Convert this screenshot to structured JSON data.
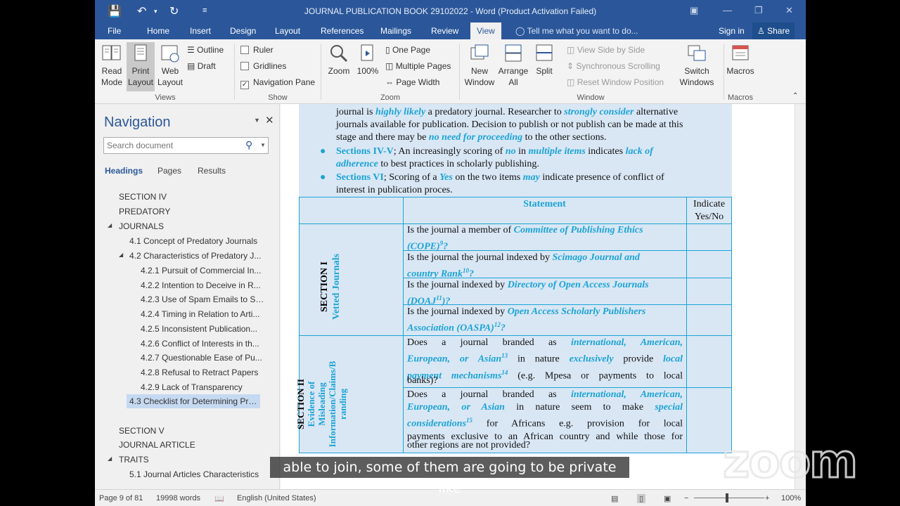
{
  "window": {
    "title": "JOURNAL PUBLICATION BOOK 29102022  -  Word (Product Activation Failed)"
  },
  "tabs": [
    "File",
    "Home",
    "Insert",
    "Design",
    "Layout",
    "References",
    "Mailings",
    "Review",
    "View"
  ],
  "tell_me": "Tell me what you want to do...",
  "sign_in": "Sign in",
  "share": "Share",
  "ribbon": {
    "views": {
      "read_mode": "Read Mode",
      "print_layout": "Print Layout",
      "web_layout": "Web Layout",
      "outline": "Outline",
      "draft": "Draft",
      "group": "Views"
    },
    "show": {
      "ruler": "Ruler",
      "gridlines": "Gridlines",
      "nav_pane": "Navigation Pane",
      "group": "Show"
    },
    "zoom": {
      "zoom": "Zoom",
      "hundred": "100%",
      "one_page": "One Page",
      "multiple_pages": "Multiple Pages",
      "page_width": "Page Width",
      "group": "Zoom"
    },
    "window": {
      "new_window": "New Window",
      "arrange_all": "Arrange All",
      "split": "Split",
      "side_by_side": "View Side by Side",
      "sync_scrolling": "Synchronous Scrolling",
      "reset_position": "Reset Window Position",
      "switch_windows": "Switch Windows",
      "group": "Window"
    },
    "macros": {
      "macros": "Macros",
      "group": "Macros"
    }
  },
  "navigation": {
    "title": "Navigation",
    "search_placeholder": "Search document",
    "tabs": [
      "Headings",
      "Pages",
      "Results"
    ],
    "items": [
      "SECTION IV",
      "PREDATORY",
      "JOURNALS",
      "4.1 Concept of Predatory Journals",
      "4.2 Characteristics of Predatory J...",
      "4.2.1 Pursuit of Commercial In...",
      "4.2.2 Intention to Deceive in R...",
      "4.2.3 Use of Spam Emails to So...",
      "4.2.4 Timing in Relation to Arti...",
      "4.2.5 Inconsistent Publication...",
      "4.2.6 Conflict of Interests in th...",
      "4.2.7 Questionable Ease of Pu...",
      "4.2.8 Refusal to Retract Papers",
      "4.2.9  Lack of Transparency",
      "4.3 Checklist for Determining Pre...",
      "SECTION V",
      "JOURNAL ARTICLE",
      "TRAITS",
      "5.1 Journal Articles Characteristics"
    ]
  },
  "document": {
    "intro": {
      "l1a": "journal is ",
      "l1b": "highly likely",
      "l1c": " a predatory journal. Researcher to ",
      "l1d": "strongly consider",
      "l1e": " alternative",
      "l2": "journals available for publication. Decision to publish or not publish can be made at this",
      "l3a": "stage and there may be ",
      "l3b": "no need for proceeding",
      "l3c": " to the other sections.",
      "b1a": "Sections IV-V",
      "b1b": "; An increasingly scoring of ",
      "b1c": "no",
      "b1d": " in ",
      "b1e": "multiple items",
      "b1f": " indicates ",
      "b1g": "lack of",
      "b1h": "adherence",
      "b1i": " to best practices in scholarly publishing.",
      "b2a": "Sections VI",
      "b2b": "; Scoring of a ",
      "b2c": "Yes",
      "b2d": " on the two items ",
      "b2e": "may",
      "b2f": " indicate presence of conflict of",
      "b2g": "interest in publication proces."
    },
    "table": {
      "header_statement": "Statement",
      "header_indicate_1": "Indicate",
      "header_indicate_2": "Yes/No",
      "section1": "SECTION I",
      "section1_sub": "Vetted Journals",
      "section2": "SECTION II",
      "section2_sub_1": "Evidence of",
      "section2_sub_2": "Misleading",
      "section2_sub_3": "Information/Claims/B",
      "section2_sub_4": "randing",
      "r1a": "Is the journal a member of ",
      "r1b": "Committee of Publishing Ethics",
      "r1c": "(COPE)",
      "r1sup": "9",
      "r1d": "?",
      "r2a": "Is the journal the journal indexed by ",
      "r2b": "Scimago Journal and",
      "r2c": "country Rank",
      "r2sup": "10",
      "r2d": "?",
      "r3a": "Is the journal indexed by ",
      "r3b": "Directory of Open Access Journals",
      "r3c": "(DOAJ",
      "r3sup": "11",
      "r3d": ")?",
      "r4a": "Is the journal indexed by ",
      "r4b": "Open Access Scholarly Publishers",
      "r4c": "Association (OASPA)",
      "r4sup": "12",
      "r4d": "?",
      "r5a": "Does a journal branded as ",
      "r5b": "international, American,",
      "r5c": "European, or Asian",
      "r5sup": "13",
      "r5d": " in nature ",
      "r5e": "exclusively",
      "r5f": " provide ",
      "r5g": "local",
      "r5h": "payment mechanisms",
      "r5sup2": "14",
      "r5i": " (e.g. Mpesa or payments to local",
      "r5j": "banks)?",
      "r6a": "Does a journal branded as ",
      "r6b": "international, American,",
      "r6c": "European, or Asian",
      "r6d": " in nature seem to make ",
      "r6e": "special",
      "r6f": "considerations",
      "r6sup": "15",
      "r6g": " for Africans e.g. provision for local",
      "r6h": "payments exclusive to an African country and while those for",
      "r6i": "other regions are not provided?"
    }
  },
  "status": {
    "page": "Page 9 of 81",
    "words": "19998 words",
    "language": "English (United States)",
    "zoom": "100%"
  },
  "caption": "able to join, some of them are going to be private like",
  "watermark": "zoom",
  "colors": {
    "accent": "#2b579a",
    "doc_highlight": "#1ca3d4",
    "table_fill": "#d9e7f5"
  }
}
